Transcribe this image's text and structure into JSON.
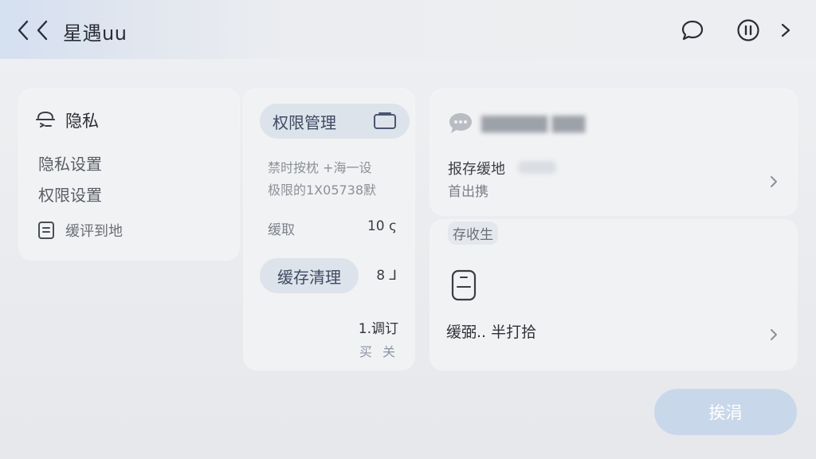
{
  "header": {
    "title": "星遇uu",
    "icons": [
      "back-icon",
      "chat-icon",
      "pause-icon",
      "chevron-right-icon"
    ]
  },
  "privacy_card": {
    "title": "隐私",
    "items": [
      {
        "label": "隐私设置"
      },
      {
        "label": "权限设置"
      }
    ],
    "save_label": "缓评到地"
  },
  "permissions_card": {
    "manage_label": "权限管理",
    "desc_line1": "禁时按枕 +海一设",
    "desc_line2": "极限的1X05738默",
    "cache_label": "缓取",
    "cache_value": "10 ς",
    "clean_label": "缓存清理",
    "clean_value": "8 ⅃",
    "footer_line1": "1.调订",
    "footer_line2": "买 关"
  },
  "right_top_card": {
    "blurred_text": "██████ ███",
    "title": "报存缓地",
    "subtitle": "首出携"
  },
  "right_bottom_card": {
    "header": "存收生",
    "label": "缓弼.. 半打拾"
  },
  "confirm_button": {
    "label": "挨涓"
  },
  "colors": {
    "accent_light": "#c9d7ea",
    "pill_bg": "#dde3ea",
    "card_bg": "#f1f2f4",
    "page_bg": "#e9ebee"
  }
}
